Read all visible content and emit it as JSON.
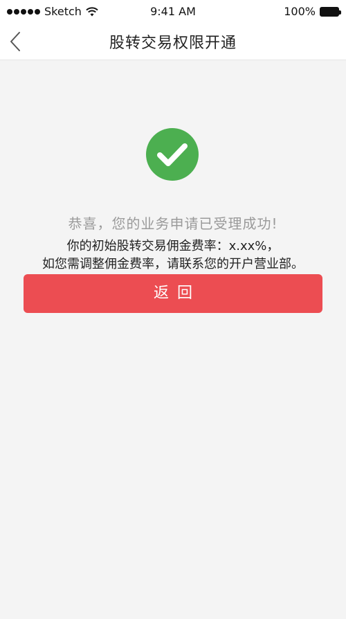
{
  "status_bar": {
    "carrier": "Sketch",
    "time": "9:41 AM",
    "battery": "100%"
  },
  "nav": {
    "title": "股转交易权限开通",
    "back_icon": "chevron-left-icon"
  },
  "result": {
    "icon": "check-circle-icon",
    "icon_color": "#4caf50",
    "title": "恭喜，您的业务申请已受理成功!",
    "line1": "你的初始股转交易佣金费率：x.xx%，",
    "line2": "如您需调整佣金费率，请联系您的开户营业部。"
  },
  "actions": {
    "return_label": "返回",
    "return_color": "#ec4d52"
  }
}
